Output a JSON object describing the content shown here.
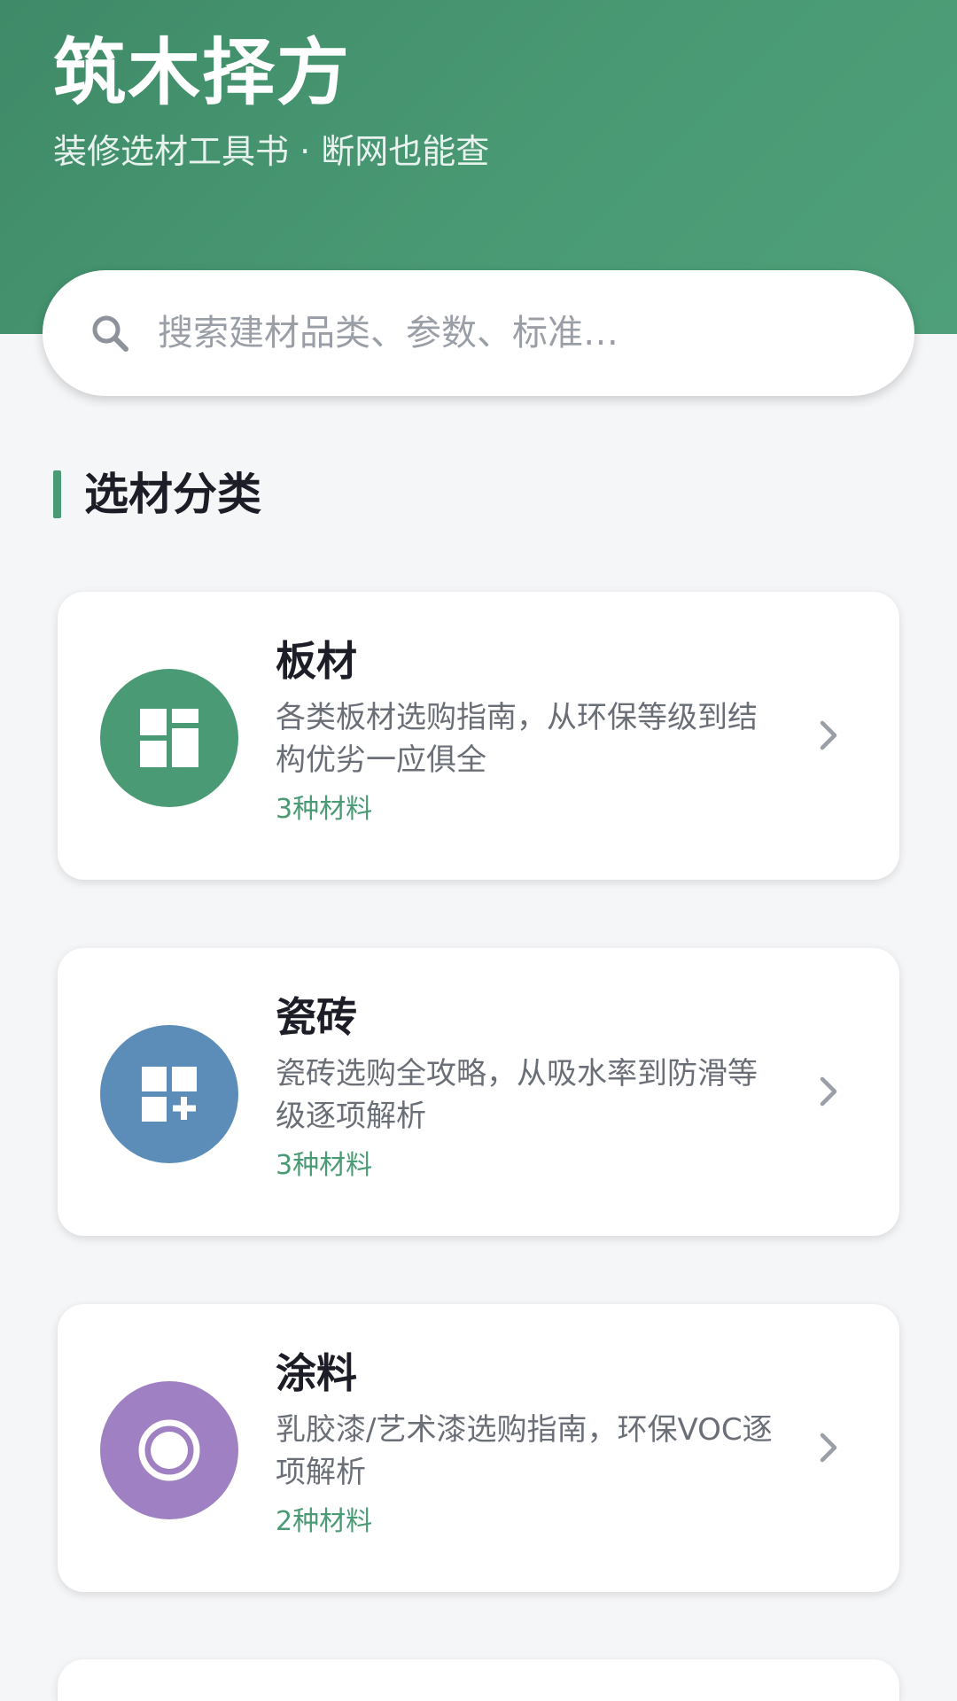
{
  "header": {
    "title": "筑木择方",
    "subtitle": "装修选材工具书 · 断网也能查",
    "gradient_colors": [
      "#3f8a68",
      "#4fa07a"
    ]
  },
  "search": {
    "placeholder": "搜索建材品类、参数、标准…",
    "icon": "search-icon"
  },
  "section": {
    "title": "选材分类",
    "accent_color": "#4a9b75"
  },
  "categories": [
    {
      "name": "板材",
      "description": "各类板材选购指南，从环保等级到结构优劣一应俱全",
      "count": "3种材料",
      "icon": "panel-grid-icon",
      "color": "#4a9b75"
    },
    {
      "name": "瓷砖",
      "description": "瓷砖选购全攻略，从吸水率到防滑等级逐项解析",
      "count": "3种材料",
      "icon": "tile-plus-icon",
      "color": "#5b8db8"
    },
    {
      "name": "涂料",
      "description": "乳胶漆/艺术漆选购指南，环保VOC逐项解析",
      "count": "2种材料",
      "icon": "paint-ring-icon",
      "color": "#9f80c2"
    }
  ]
}
